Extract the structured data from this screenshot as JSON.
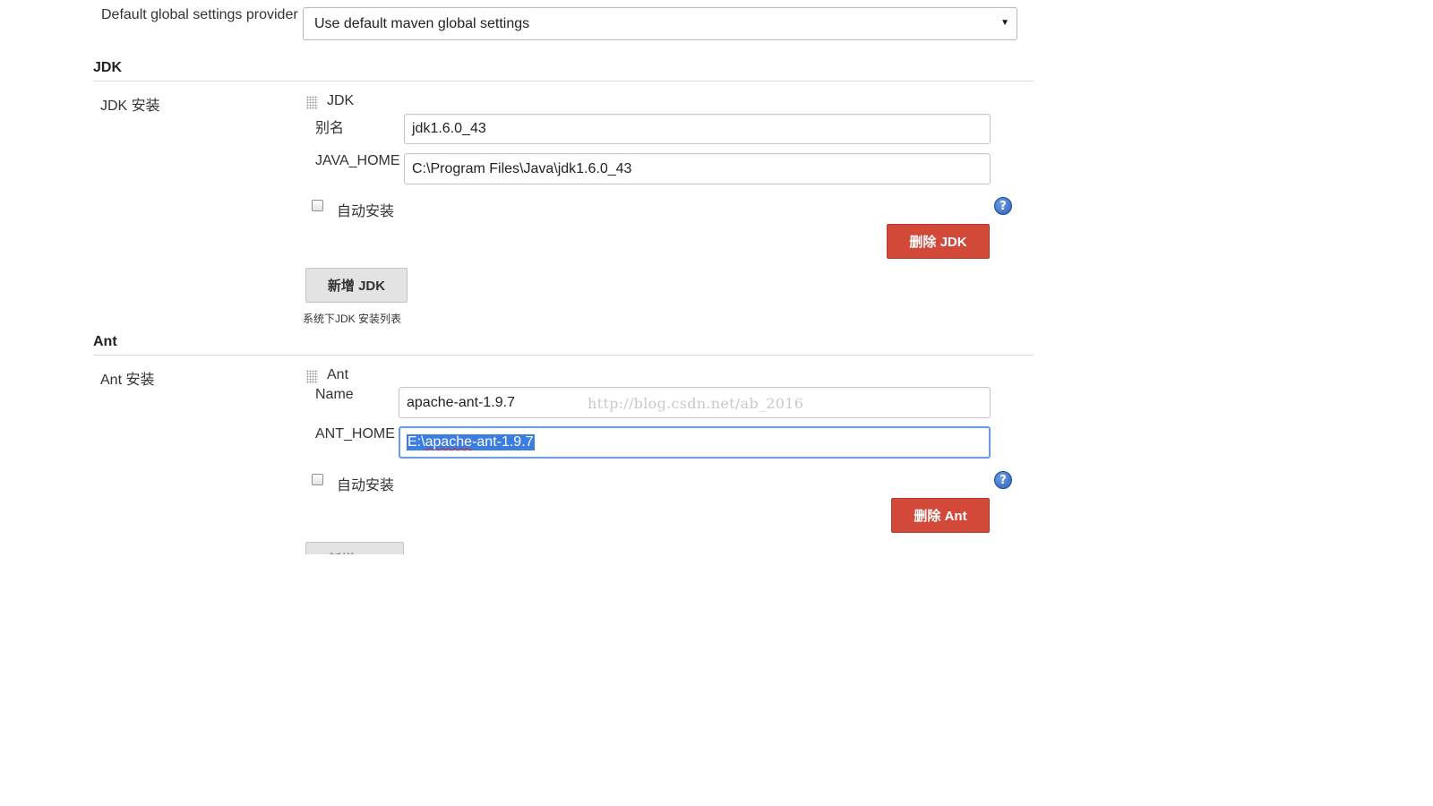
{
  "maven": {
    "settings_label": "Default global settings provider",
    "settings_value": "Use default maven global settings"
  },
  "jdk": {
    "section_title": "JDK",
    "install_label": "JDK 安装",
    "item_title": "JDK",
    "name_label": "别名",
    "name_value": "jdk1.6.0_43",
    "home_label": "JAVA_HOME",
    "home_value": "C:\\Program Files\\Java\\jdk1.6.0_43",
    "auto_install_label": "自动安装",
    "delete_button": "删除 JDK",
    "add_button": "新增 JDK",
    "hint": "系统下JDK 安装列表"
  },
  "ant": {
    "section_title": "Ant",
    "install_label": "Ant 安装",
    "item_title": "Ant",
    "name_label": "Name",
    "name_value": "apache-ant-1.9.7",
    "home_label": "ANT_HOME",
    "home_value_prefix": "E:\\",
    "home_value_underlined": "apache",
    "home_value_suffix": "-ant-1.9.7",
    "auto_install_label": "自动安装",
    "delete_button": "删除 Ant",
    "add_button": "新增 Ant"
  },
  "watermark": "http://blog.csdn.net/ab_2016",
  "icons": {
    "help": "?",
    "dropdown": "▼"
  },
  "colors": {
    "danger": "#d24939",
    "focus": "#6d9be3",
    "selection": "#3b7de0"
  }
}
